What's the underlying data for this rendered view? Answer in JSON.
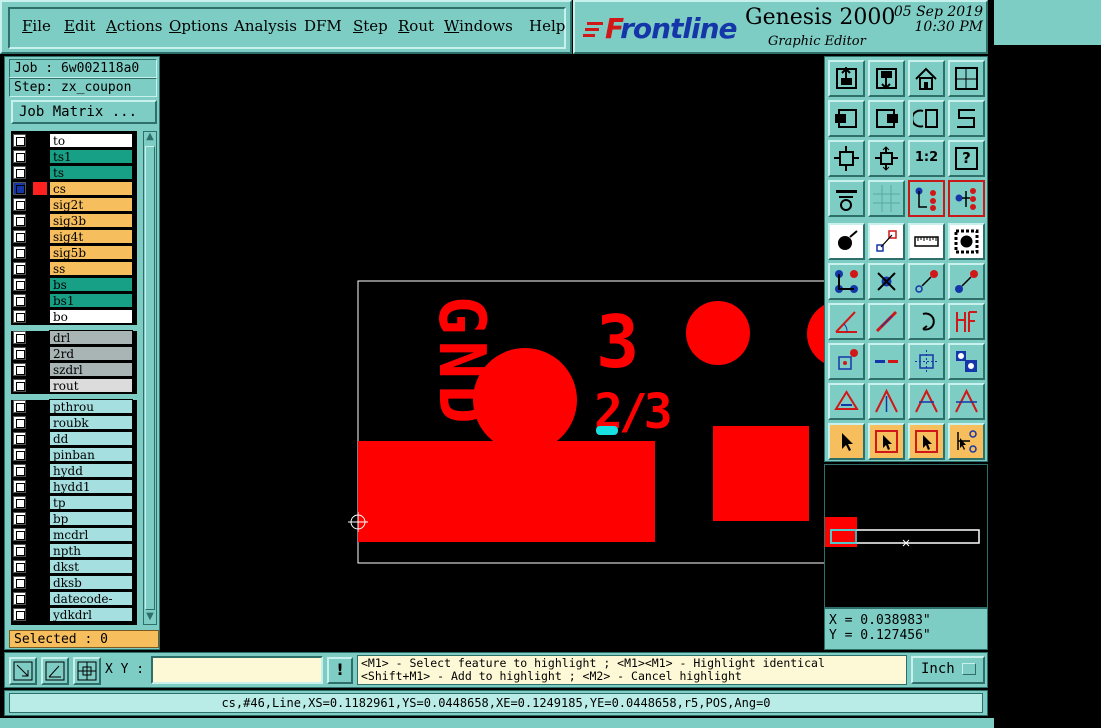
{
  "menu": {
    "items": [
      {
        "label": "File",
        "ul": "F",
        "rest": "ile"
      },
      {
        "label": "Edit",
        "ul": "E",
        "rest": "dit"
      },
      {
        "label": "Actions",
        "ul": "A",
        "rest": "ctions"
      },
      {
        "label": "Options",
        "ul": "O",
        "rest": "ptions"
      },
      {
        "label": "Analysis",
        "ul": "",
        "rest": "Analysis"
      },
      {
        "label": "DFM",
        "ul": "",
        "rest": "DFM"
      },
      {
        "label": "Step",
        "ul": "S",
        "rest": "tep"
      },
      {
        "label": "Rout",
        "ul": "R",
        "rest": "out"
      },
      {
        "label": "Windows",
        "ul": "W",
        "rest": "indows"
      },
      {
        "label": "Help",
        "ul": "",
        "rest": "Help"
      }
    ]
  },
  "brand": {
    "logo_prefix": "F",
    "logo_text": "rontline",
    "app_name": "Genesis 2000",
    "subtitle": "Graphic Editor",
    "date": "05 Sep 2019",
    "time": "10:30 PM"
  },
  "job": {
    "job_label": "Job : 6w002118a0",
    "step_label": "Step: zx_coupon",
    "matrix_button": "Job Matrix ..."
  },
  "layers": [
    {
      "name": "to",
      "color": "#ffffff"
    },
    {
      "name": "ts1",
      "color": "#17a086"
    },
    {
      "name": "ts",
      "color": "#17a086"
    },
    {
      "name": "cs",
      "color": "#f7be5e",
      "active": true
    },
    {
      "name": "sig2t",
      "color": "#f7be5e"
    },
    {
      "name": "sig3b",
      "color": "#f7be5e"
    },
    {
      "name": "sig4t",
      "color": "#f7be5e"
    },
    {
      "name": "sig5b",
      "color": "#f7be5e"
    },
    {
      "name": "ss",
      "color": "#f7be5e"
    },
    {
      "name": "bs",
      "color": "#17a086"
    },
    {
      "name": "bs1",
      "color": "#17a086"
    },
    {
      "name": "bo",
      "color": "#ffffff"
    },
    {
      "name": "drl",
      "color": "#a9b4b4",
      "group_break": true
    },
    {
      "name": "2rd",
      "color": "#a9b4b4"
    },
    {
      "name": "szdrl",
      "color": "#a9b4b4"
    },
    {
      "name": "rout",
      "color": "#dcdcdc"
    },
    {
      "name": "pthrou",
      "color": "#a6dfe0",
      "group_break": true
    },
    {
      "name": "roubk",
      "color": "#a6dfe0"
    },
    {
      "name": "dd",
      "color": "#a6dfe0"
    },
    {
      "name": "pinban",
      "color": "#a6dfe0"
    },
    {
      "name": "hydd",
      "color": "#a6dfe0"
    },
    {
      "name": "hydd1",
      "color": "#a6dfe0"
    },
    {
      "name": "tp",
      "color": "#a6dfe0"
    },
    {
      "name": "bp",
      "color": "#a6dfe0"
    },
    {
      "name": "mcdrl",
      "color": "#a6dfe0"
    },
    {
      "name": "npth",
      "color": "#a6dfe0"
    },
    {
      "name": "dkst",
      "color": "#a6dfe0"
    },
    {
      "name": "dksb",
      "color": "#a6dfe0"
    },
    {
      "name": "datecode-pbo",
      "color": "#a6dfe0"
    },
    {
      "name": "ydkdrl",
      "color": "#a6dfe0"
    }
  ],
  "selected": "Selected : 0",
  "canvas": {
    "gnd_text": "GND",
    "num_3": "3",
    "frac_text": "2/3",
    "feature_color": "#ff0000",
    "highlight_color": "#19e0e0"
  },
  "toolbar": {
    "ratio_label": "1:2",
    "help_label": "?"
  },
  "coords": {
    "x": "X = 0.038983\"",
    "y": "Y = 0.127456\""
  },
  "bottom": {
    "xy_label": "X Y :",
    "xy_value": "",
    "exclaim": "!",
    "hint_line1": "<M1> - Select feature to highlight ; <M1><M1> - Highlight identical",
    "hint_line2": "<Shift+M1> - Add to highlight ; <M2> - Cancel highlight",
    "unit": "Inch"
  },
  "status": "cs,#46,Line,XS=0.1182961,YS=0.0448658,XE=0.1249185,YE=0.0448658,r5,POS,Ang=0"
}
